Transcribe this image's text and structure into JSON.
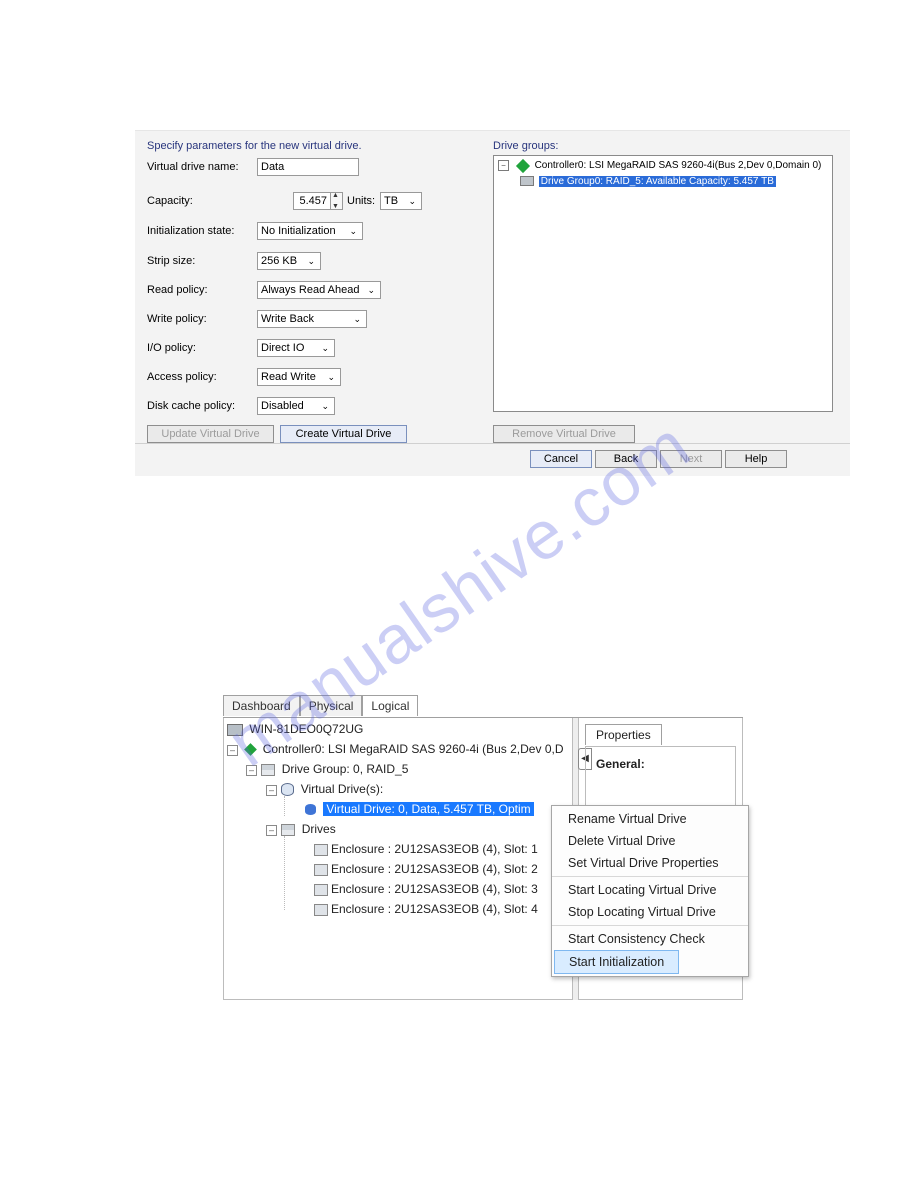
{
  "panel1": {
    "title_left": "Specify parameters for the new virtual drive.",
    "name_label": "Virtual drive name:",
    "name_value": "Data",
    "capacity_label": "Capacity:",
    "capacity_value": "5.457",
    "units_label": "Units:",
    "units_value": "TB",
    "init_label": "Initialization state:",
    "init_value": "No Initialization",
    "strip_label": "Strip size:",
    "strip_value": "256 KB",
    "read_label": "Read policy:",
    "read_value": "Always Read Ahead",
    "write_label": "Write policy:",
    "write_value": "Write Back",
    "io_label": "I/O policy:",
    "io_value": "Direct IO",
    "access_label": "Access policy:",
    "access_value": "Read Write",
    "cache_label": "Disk cache policy:",
    "cache_value": "Disabled",
    "btn_update": "Update Virtual Drive",
    "btn_create": "Create Virtual Drive",
    "title_right": "Drive groups:",
    "tree_controller": "Controller0: LSI MegaRAID SAS 9260-4i(Bus 2,Dev 0,Domain 0)",
    "tree_group": "Drive Group0: RAID_5: Available Capacity: 5.457 TB",
    "btn_remove": "Remove Virtual Drive",
    "btn_cancel": "Cancel",
    "btn_back": "Back",
    "btn_next": "Next",
    "btn_help": "Help"
  },
  "watermark": "manualshive.com",
  "panel2": {
    "tabs": {
      "dashboard": "Dashboard",
      "physical": "Physical",
      "logical": "Logical"
    },
    "host": "WIN-81DEO0Q72UG",
    "controller": "Controller0: LSI MegaRAID SAS 9260-4i (Bus 2,Dev 0,D",
    "drivegroup": "Drive Group: 0, RAID_5",
    "virtualdrives": "Virtual Drive(s):",
    "virtualdrive_sel": "Virtual Drive: 0, Data, 5.457 TB, Optim",
    "drives_label": "Drives",
    "enclosures": [
      "Enclosure : 2U12SAS3EOB (4), Slot: 1",
      "Enclosure : 2U12SAS3EOB (4), Slot: 2",
      "Enclosure : 2U12SAS3EOB (4), Slot: 3",
      "Enclosure : 2U12SAS3EOB (4), Slot: 4"
    ],
    "prop_tab": "Properties",
    "general": "General:",
    "context_menu": [
      "Rename Virtual Drive",
      "Delete Virtual Drive",
      "Set Virtual Drive Properties",
      "Start Locating Virtual Drive",
      "Stop Locating Virtual Drive",
      "Start Consistency Check",
      "Start Initialization"
    ]
  }
}
